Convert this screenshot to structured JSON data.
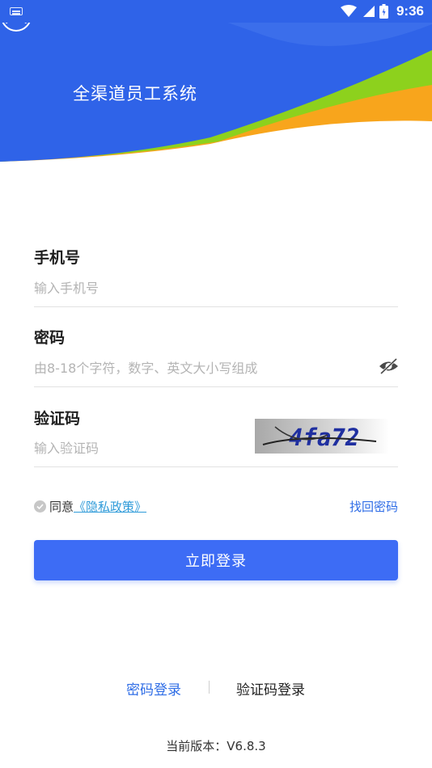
{
  "status_bar": {
    "time": "9:36",
    "icons": [
      "keyboard-icon",
      "wifi-icon",
      "signal-icon",
      "battery-icon"
    ]
  },
  "header": {
    "title": "全渠道员工系统",
    "colors": {
      "blue": "#2f63e8",
      "green": "#8dd11d",
      "orange": "#f8a51c"
    }
  },
  "form": {
    "phone": {
      "label": "手机号",
      "placeholder": "输入手机号",
      "value": ""
    },
    "password": {
      "label": "密码",
      "placeholder": "由8-18个字符，数字、英文大小写组成",
      "value": ""
    },
    "captcha": {
      "label": "验证码",
      "placeholder": "输入验证码",
      "value": "",
      "image_text": "4fa72"
    }
  },
  "agreement": {
    "prefix": "同意",
    "link": "《隐私政策》"
  },
  "forgot_password": "找回密码",
  "login_button": "立即登录",
  "login_modes": {
    "password": "密码登录",
    "sms": "验证码登录"
  },
  "version": "当前版本：V6.8.3",
  "colors": {
    "accent": "#3d6cf5",
    "link": "#2f6de6"
  }
}
